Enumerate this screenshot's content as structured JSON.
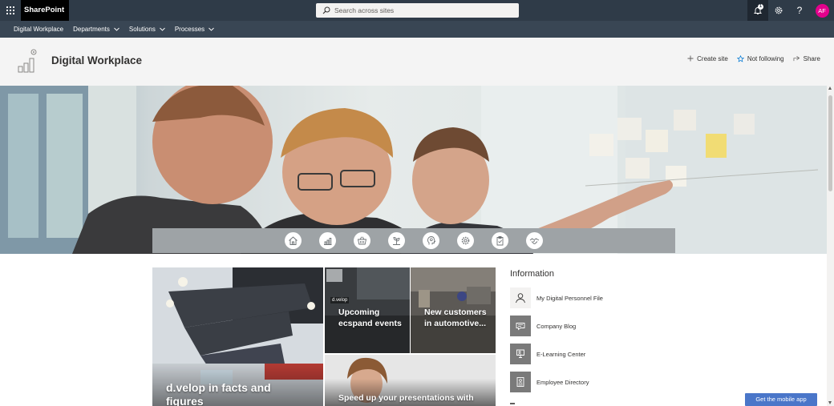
{
  "suite_bar": {
    "brand": "SharePoint",
    "search_placeholder": "Search across sites",
    "notification_count": "1",
    "help_label": "?",
    "avatar_initials": "AF"
  },
  "hub_nav": {
    "items": [
      {
        "label": "Digital Workplace"
      },
      {
        "label": "Departments"
      },
      {
        "label": "Solutions"
      },
      {
        "label": "Processes"
      }
    ]
  },
  "site_header": {
    "title": "Digital Workplace",
    "actions": {
      "create_site": "Create site",
      "not_following": "Not following",
      "share": "Share"
    }
  },
  "hero": {
    "icon_bar": [
      "home-icon",
      "chart-icon",
      "basket-icon",
      "plant-icon",
      "head-icon",
      "gear-icon",
      "clipboard-icon",
      "handshake-icon"
    ]
  },
  "tiles": {
    "main": "d.velop in facts and figures",
    "events": "Upcoming ecspand events",
    "events_tag": "d.velop",
    "customers": "New customers in automotive...",
    "presentations": "Speed up your presentations with"
  },
  "information": {
    "title": "Information",
    "items": [
      {
        "label": "My Digital Personnel File",
        "icon": "person-icon"
      },
      {
        "label": "Company Blog",
        "icon": "blog-icon"
      },
      {
        "label": "E-Learning Center",
        "icon": "elearning-icon"
      },
      {
        "label": "Employee Directory",
        "icon": "directory-icon"
      }
    ]
  },
  "mobile_app_button": "Get the mobile app",
  "colors": {
    "suite_bar": "#2f3b48",
    "hub_nav": "#394654",
    "header_bg": "#f4f4f4",
    "icon_bar": "#9ea3a6",
    "avatar": "#e3008c",
    "mobile_button": "#4a76c9"
  }
}
